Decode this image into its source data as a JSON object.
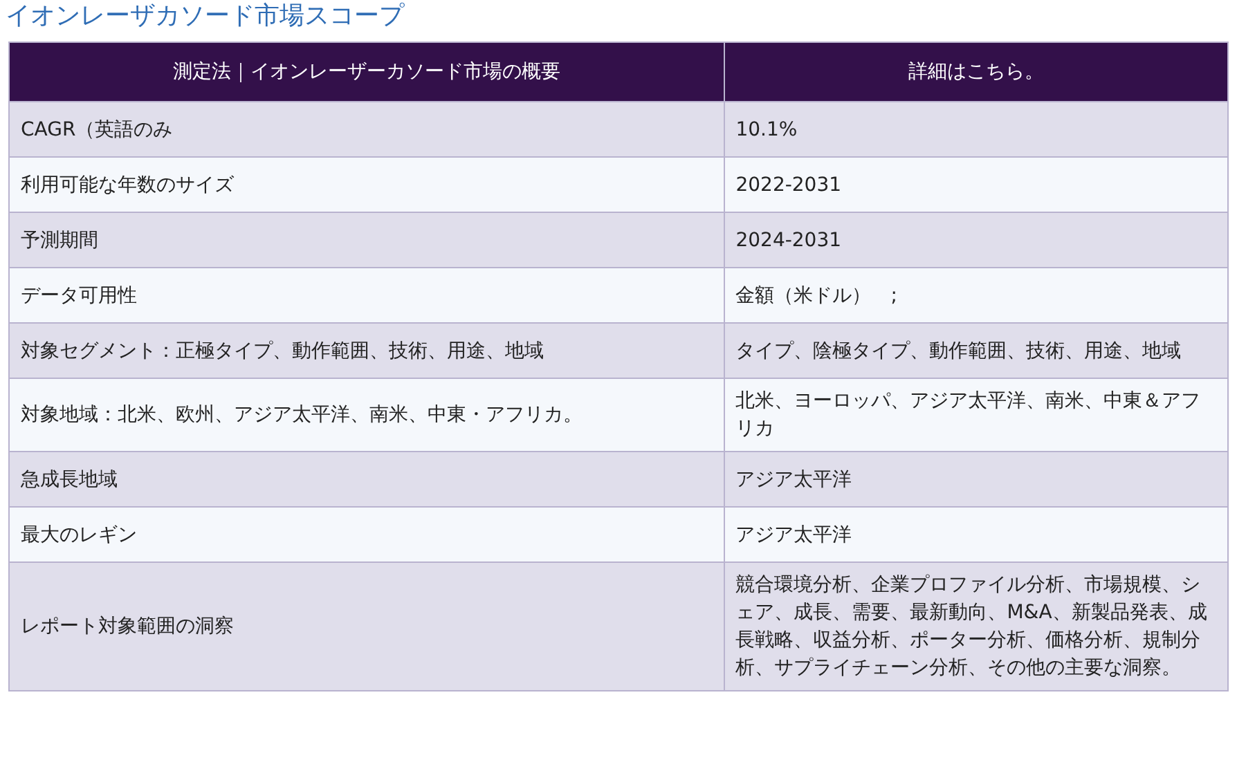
{
  "title": "イオンレーザカソード市場スコープ",
  "table": {
    "columns": [
      "測定法｜イオンレーザーカソード市場の概要",
      "詳細はこちら。"
    ],
    "rows": [
      {
        "label": "CAGR（英語のみ",
        "value": "10.1%"
      },
      {
        "label": "利用可能な年数のサイズ",
        "value": "2022-2031"
      },
      {
        "label": "予測期間",
        "value": "2024-2031"
      },
      {
        "label": "データ可用性",
        "value": "金額（米ドル）　;"
      },
      {
        "label": "対象セグメント：正極タイプ、動作範囲、技術、用途、地域",
        "value": "タイプ、陰極タイプ、動作範囲、技術、用途、地域"
      },
      {
        "label": "対象地域：北米、欧州、アジア太平洋、南米、中東・アフリカ。",
        "value": "北米、ヨーロッパ、アジア太平洋、南米、中東＆アフリカ"
      },
      {
        "label": "急成長地域",
        "value": "アジア太平洋"
      },
      {
        "label": "最大のレギン",
        "value": "アジア太平洋"
      },
      {
        "label": "レポート対象範囲の洞察",
        "value": "競合環境分析、企業プロファイル分析、市場規模、シェア、成長、需要、最新動向、M&A、新製品発表、成長戦略、収益分析、ポーター分析、価格分析、規制分析、サプライチェーン分析、その他の主要な洞察。"
      }
    ]
  }
}
